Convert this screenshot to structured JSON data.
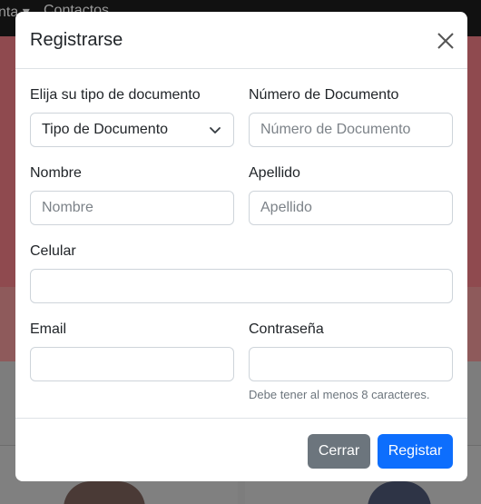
{
  "background": {
    "nav_items": [
      "nta ▾",
      "Contactos"
    ]
  },
  "modal": {
    "title": "Registrarse",
    "close_icon": "close-icon",
    "fields": {
      "doc_type": {
        "label": "Elija su tipo de documento",
        "selected": "Tipo de Documento"
      },
      "doc_number": {
        "label": "Número de Documento",
        "placeholder": "Número de Documento",
        "value": ""
      },
      "first_name": {
        "label": "Nombre",
        "placeholder": "Nombre",
        "value": ""
      },
      "last_name": {
        "label": "Apellido",
        "placeholder": "Apellido",
        "value": ""
      },
      "phone": {
        "label": "Celular",
        "placeholder": "",
        "value": ""
      },
      "email": {
        "label": "Email",
        "placeholder": "",
        "value": ""
      },
      "password": {
        "label": "Contraseña",
        "placeholder": "",
        "value": "",
        "help": "Debe tener al menos 8 caracteres."
      }
    },
    "buttons": {
      "cancel": "Cerrar",
      "submit": "Registar"
    }
  },
  "colors": {
    "primary": "#0d6efd",
    "secondary": "#6c757d",
    "border": "#ced4da"
  }
}
